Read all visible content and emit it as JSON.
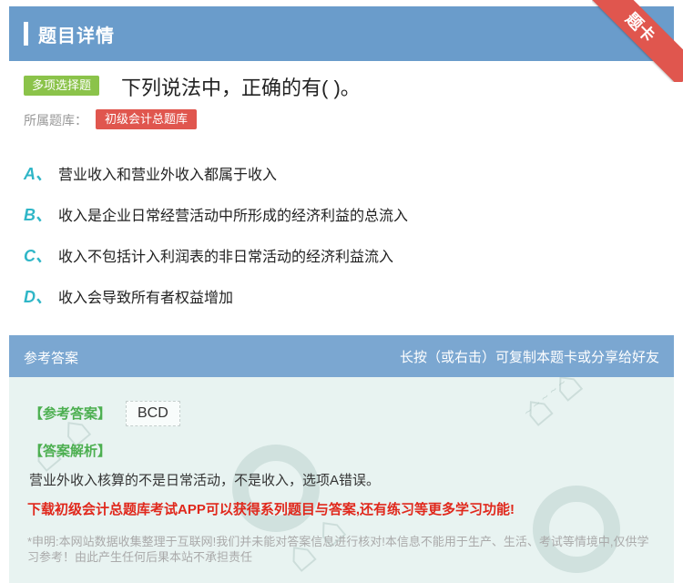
{
  "header": {
    "title": "题目详情"
  },
  "ribbon": {
    "label": "题卡"
  },
  "question": {
    "type_label": "多项选择题",
    "text": "下列说法中，正确的有( )。",
    "bank_label": "所属题库：",
    "bank_name": "初级会计总题库",
    "options": [
      {
        "letter": "A、",
        "text": "营业收入和营业外收入都属于收入"
      },
      {
        "letter": "B、",
        "text": "收入是企业日常经营活动中所形成的经济利益的总流入"
      },
      {
        "letter": "C、",
        "text": "收入不包括计入利润表的非日常活动的经济利益流入"
      },
      {
        "letter": "D、",
        "text": "收入会导致所有者权益增加"
      }
    ]
  },
  "answer": {
    "section_label": "参考答案",
    "hint": "长按（或右击）可复制本题卡或分享给好友",
    "key_label": "【参考答案】",
    "key_value": "BCD",
    "analysis_label": "【答案解析】",
    "analysis_text": "营业外收入核算的不是日常活动，不是收入，选项A错误。",
    "promo": "下载初级会计总题库考试APP可以获得系列题目与答案,还有练习等更多学习功能!",
    "disclaimer": "*申明:本网站数据收集整理于互联网!我们并未能对答案信息进行核对!本信息不能用于生产、生活、考试等情境中,仅供学习参考！由此产生任何后果本站不承担责任"
  },
  "colors": {
    "header_bg": "#6a9ccb",
    "ribbon_bg": "#e0564e",
    "type_tag": "#8bc34a",
    "option_letter": "#2fb6c7",
    "answer_key": "#4caf50",
    "promo": "#e0281c"
  }
}
